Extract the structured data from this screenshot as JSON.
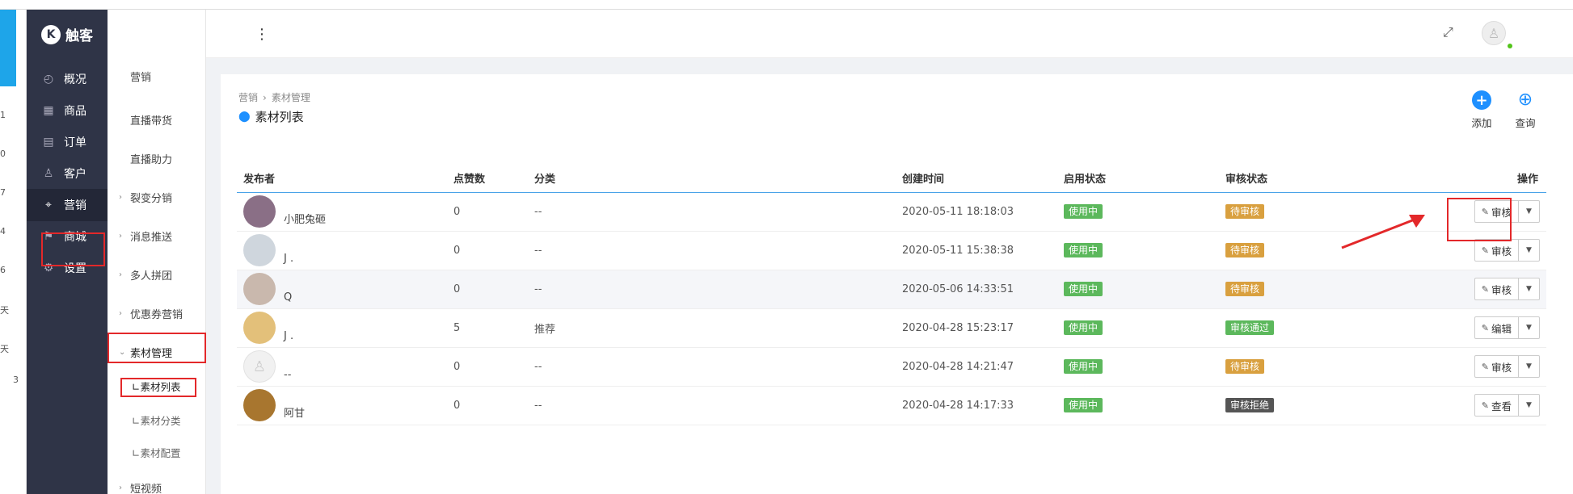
{
  "sidebar": {
    "logo_text": "触客",
    "items": [
      {
        "label": "概况",
        "icon": "dashboard-icon",
        "glyph": "◴"
      },
      {
        "label": "商品",
        "icon": "grid-icon",
        "glyph": "▦"
      },
      {
        "label": "订单",
        "icon": "calendar-icon",
        "glyph": "▤"
      },
      {
        "label": "客户",
        "icon": "user-icon",
        "glyph": "♙"
      },
      {
        "label": "营销",
        "icon": "tag-icon",
        "glyph": "⌖"
      },
      {
        "label": "商城",
        "icon": "store-icon",
        "glyph": "⚑"
      },
      {
        "label": "设置",
        "icon": "gear-icon",
        "glyph": "⚙"
      }
    ]
  },
  "edge_numbers": [
    "1",
    "0",
    "7",
    "4",
    "6",
    "天",
    "天",
    "3"
  ],
  "submenu": {
    "items": [
      {
        "label": "营销"
      },
      {
        "label": "直播带货"
      },
      {
        "label": "直播助力"
      },
      {
        "label": "裂变分销"
      },
      {
        "label": "消息推送"
      },
      {
        "label": "多人拼团"
      },
      {
        "label": "优惠券营销"
      },
      {
        "label": "素材管理"
      },
      {
        "label": "∟素材列表"
      },
      {
        "label": "∟素材分类"
      },
      {
        "label": "∟素材配置"
      },
      {
        "label": "短视频"
      }
    ]
  },
  "breadcrumb": {
    "root": "营销",
    "current": "素材管理"
  },
  "page_title": "素材列表",
  "toolbar": {
    "add_label": "添加",
    "query_label": "查询"
  },
  "table": {
    "columns": [
      "发布者",
      "点赞数",
      "分类",
      "创建时间",
      "启用状态",
      "审核状态",
      "操作"
    ],
    "rows": [
      {
        "publisher": "小肥兔砸",
        "likes": "0",
        "category": "--",
        "created": "2020-05-11 18:18:03",
        "enabled": "使用中",
        "review": "待审核",
        "action": "审核"
      },
      {
        "publisher": "J .",
        "likes": "0",
        "category": "--",
        "created": "2020-05-11 15:38:38",
        "enabled": "使用中",
        "review": "待审核",
        "action": "审核"
      },
      {
        "publisher": "Q",
        "likes": "0",
        "category": "--",
        "created": "2020-05-06 14:33:51",
        "enabled": "使用中",
        "review": "待审核",
        "action": "审核"
      },
      {
        "publisher": "J .",
        "likes": "5",
        "category": "推荐",
        "created": "2020-04-28 15:23:17",
        "enabled": "使用中",
        "review": "审核通过",
        "action": "编辑"
      },
      {
        "publisher": "--",
        "likes": "0",
        "category": "--",
        "created": "2020-04-28 14:21:47",
        "enabled": "使用中",
        "review": "待审核",
        "action": "审核"
      },
      {
        "publisher": "阿甘",
        "likes": "0",
        "category": "--",
        "created": "2020-04-28 14:17:33",
        "enabled": "使用中",
        "review": "审核拒绝",
        "action": "查看"
      }
    ]
  },
  "colors": {
    "sidebar_bg": "#2f3447",
    "accent": "#1e90ff",
    "tag_enabled": "#5cb85c",
    "tag_pending": "#d9a03f",
    "tag_approved": "#5cb85c",
    "tag_rejected": "#555555",
    "annotation_red": "#e3282a"
  }
}
